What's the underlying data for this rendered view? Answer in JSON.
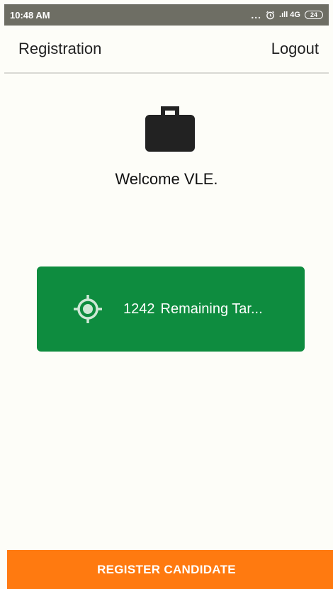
{
  "status_bar": {
    "time": "10:48 AM",
    "dots": "...",
    "alarm_icon": "alarm-clock-icon",
    "signal_text": ".ıll 4G",
    "battery": "24"
  },
  "app_bar": {
    "title": "Registration",
    "logout_label": "Logout"
  },
  "main": {
    "icon": "briefcase-icon",
    "welcome_text": "Welcome VLE."
  },
  "target_card": {
    "icon": "gps-target-icon",
    "count": "1242",
    "label": "Remaining Tar...",
    "color": "#0e8c3f"
  },
  "register_button": {
    "label": "REGISTER CANDIDATE",
    "color": "#ff7a10"
  }
}
